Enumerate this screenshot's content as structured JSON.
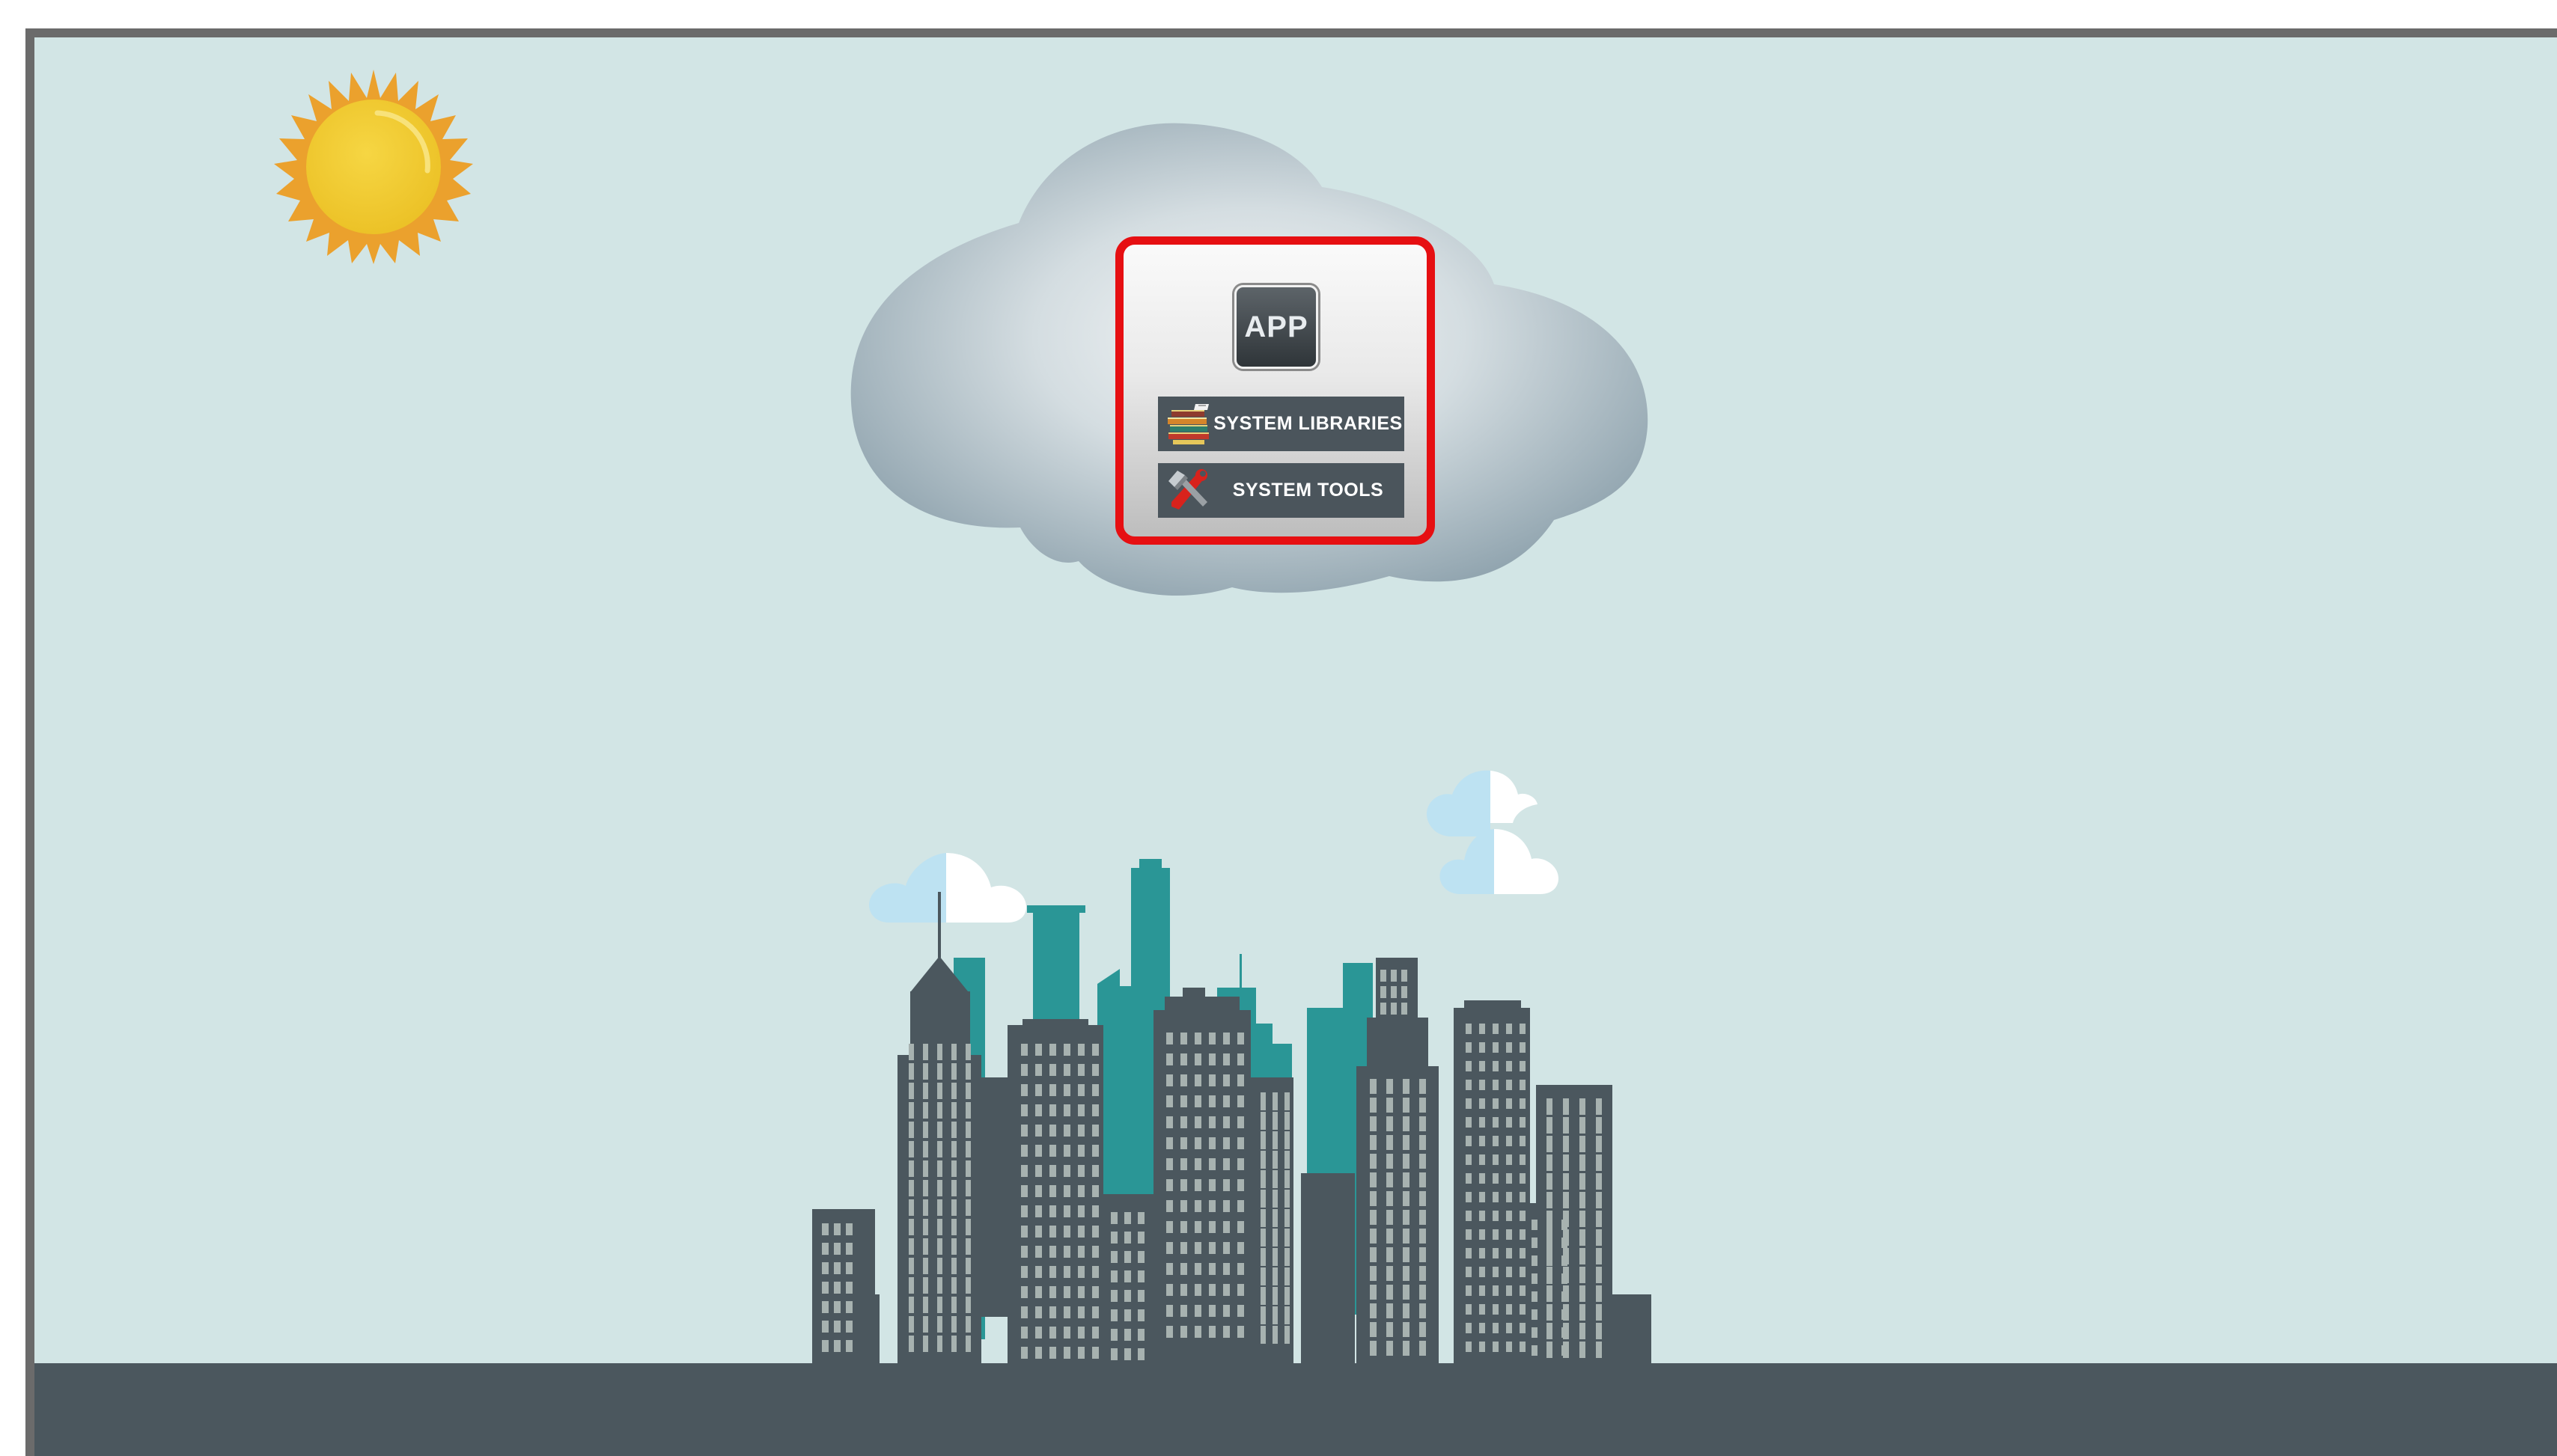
{
  "panel": {
    "app_label": "APP",
    "items": [
      {
        "label": "SYSTEM LIBRARIES",
        "icon": "books-icon"
      },
      {
        "label": "SYSTEM TOOLS",
        "icon": "hammer-wrench-icon"
      }
    ]
  },
  "colors": {
    "sky": "#d2e5e5",
    "ground": "#4b575e",
    "frame": "#6b6b6b",
    "highlight_border": "#e60f12",
    "storage_cloud": "#8fa4af",
    "building_dark": "#4b575e",
    "building_teal": "#2a9696",
    "sun_core": "#efc62a",
    "sun_rays": "#eba12d"
  }
}
